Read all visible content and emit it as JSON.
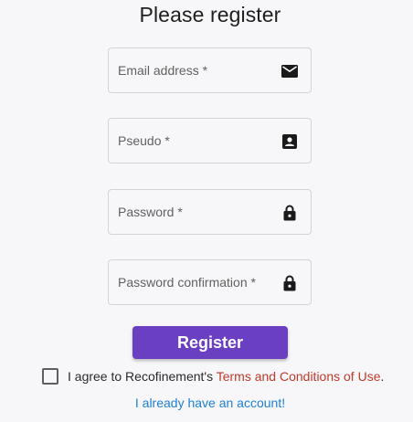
{
  "page": {
    "title": "Please register"
  },
  "form": {
    "email": {
      "label": "Email address *",
      "icon": "email-icon"
    },
    "pseudo": {
      "label": "Pseudo *",
      "icon": "contact-card-icon"
    },
    "password": {
      "label": "Password *",
      "icon": "lock-icon"
    },
    "password_confirmation": {
      "label": "Password confirmation *",
      "icon": "lock-icon"
    },
    "register_label": "Register"
  },
  "agreement": {
    "prefix": "I agree to Recofinement's ",
    "terms_link": "Terms and Conditions of Use",
    "suffix": "."
  },
  "account_link": "I already have an account!",
  "colors": {
    "primary_button": "#6a3fc1",
    "terms_link": "#c0392b",
    "account_link": "#1e7fd6",
    "background": "#f7f7f9"
  }
}
